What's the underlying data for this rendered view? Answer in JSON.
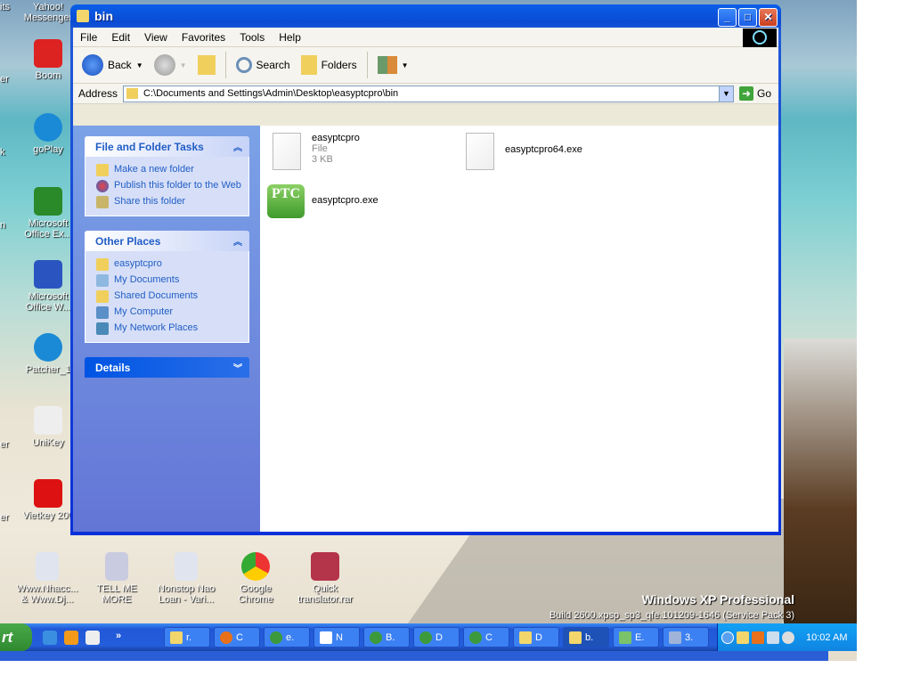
{
  "desktop": {
    "icons": [
      {
        "label": "Yahoo! Messenger",
        "color": "#7b3fa8"
      },
      {
        "label": "Boom",
        "color": "#d22"
      },
      {
        "label": "goPlay",
        "color": "#1a8ad6"
      },
      {
        "label": "Microsoft Office Ex...",
        "color": "#2a8a2a"
      },
      {
        "label": "Microsoft Office W...",
        "color": "#2a55c0"
      },
      {
        "label": "Patcher_1",
        "color": "#1a8ad6"
      },
      {
        "label": "UniKey",
        "color": "#eee"
      },
      {
        "label": "Vietkey 200",
        "color": "#d11"
      }
    ],
    "cut_labels": [
      "its",
      "er",
      "k",
      "n",
      "er",
      "er"
    ],
    "bottom_icons": [
      {
        "label": "Www.Nhacc... & Www.Dj...",
        "color": "#dfe4ef"
      },
      {
        "label": "TELL ME MORE",
        "color": "#c9cbe0"
      },
      {
        "label": "Nonstop Nao Loan - Vari...",
        "color": "#dfe4ef"
      },
      {
        "label": "Google Chrome",
        "color": "#e33"
      },
      {
        "label": "Quick translator.rar",
        "color": "#b4344a"
      }
    ],
    "os_name": "Windows XP Professional",
    "os_build": "Build 2600.xpsp_sp3_qfe.101209-1646 (Service Pack 3)"
  },
  "window": {
    "title": "bin",
    "menu": [
      "File",
      "Edit",
      "View",
      "Favorites",
      "Tools",
      "Help"
    ],
    "toolbar": {
      "back": "Back",
      "search": "Search",
      "folders": "Folders"
    },
    "address": {
      "label": "Address",
      "value": "C:\\Documents and Settings\\Admin\\Desktop\\easyptcpro\\bin",
      "go": "Go"
    },
    "tasks": {
      "title": "File and Folder Tasks",
      "items": [
        "Make a new folder",
        "Publish this folder to the Web",
        "Share this folder"
      ]
    },
    "places": {
      "title": "Other Places",
      "items": [
        "easyptcpro",
        "My Documents",
        "Shared Documents",
        "My Computer",
        "My Network Places"
      ]
    },
    "details": {
      "title": "Details"
    },
    "files": [
      {
        "name": "easyptcpro",
        "type": "File",
        "size": "3 KB"
      },
      {
        "name": "easyptcpro64.exe"
      },
      {
        "name": "easyptcpro.exe",
        "icon_text": "PTC"
      }
    ]
  },
  "taskbar": {
    "start": "rt",
    "more": "»",
    "buttons": [
      {
        "label": "r.",
        "color": "#f3d66b"
      },
      {
        "label": "C",
        "color": "#e8701a"
      },
      {
        "label": "e.",
        "color": "#3c9a3c"
      },
      {
        "label": "N",
        "color": "#fff"
      },
      {
        "label": "B.",
        "color": "#3c9a3c"
      },
      {
        "label": "D",
        "color": "#3c9a3c"
      },
      {
        "label": "C",
        "color": "#3c9a3c"
      },
      {
        "label": "D",
        "color": "#f3d66b"
      },
      {
        "label": "b.",
        "color": "#f3d66b"
      },
      {
        "label": "E.",
        "color": "#7ac36a"
      },
      {
        "label": "3.",
        "color": "#9fb4d8"
      }
    ],
    "clock": "10:02 AM"
  }
}
